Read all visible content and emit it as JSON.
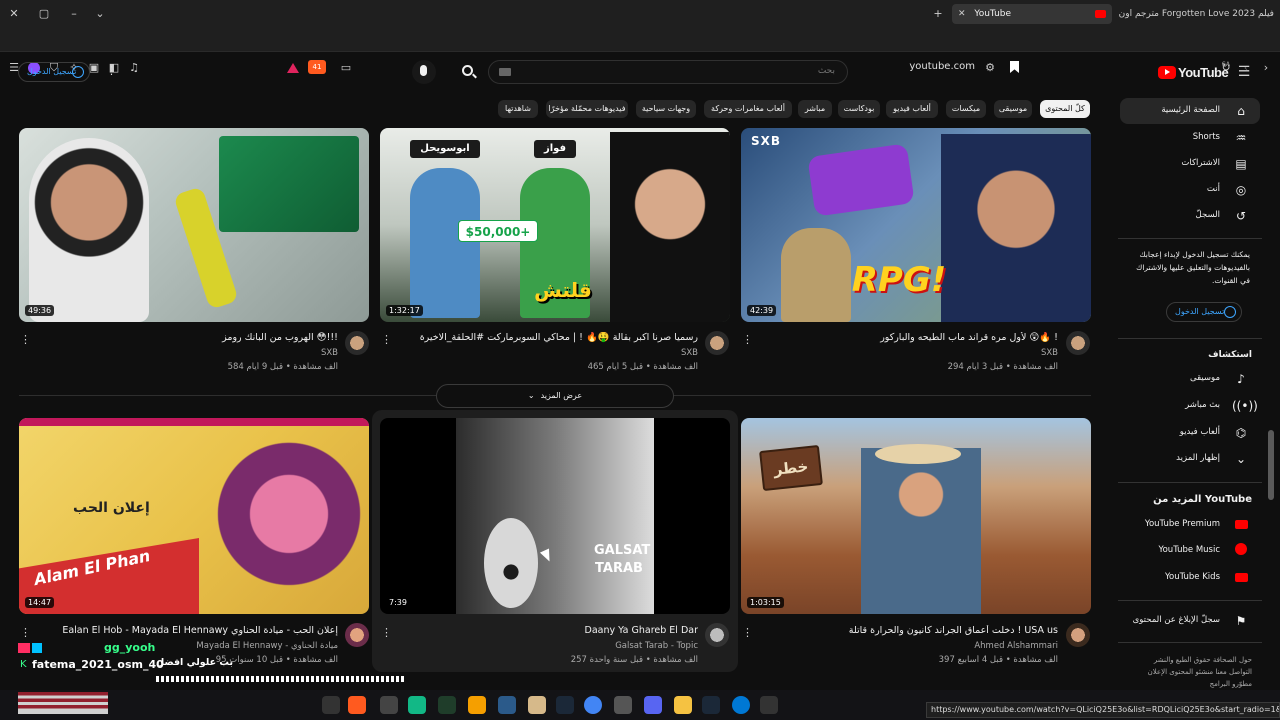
{
  "browser": {
    "tabs": [
      {
        "label": "YouTube",
        "active": true
      },
      {
        "label": "فيلم Forgotten Love 2023 مترجم اون",
        "active": false
      }
    ],
    "url": "youtube.com",
    "badge_count": "41",
    "status_url": "https://www.youtube.com/watch?v=QLiciQ25E3o&list=RDQLiciQ25E3o&start_radio=1&pp=oAcB"
  },
  "header": {
    "logo_text": "YouTube",
    "logo_region": "SA",
    "search_placeholder": "بحث",
    "signin_label": "تسجيل الدخول"
  },
  "chips": [
    {
      "label": "كلّ المحتوى",
      "active": true
    },
    {
      "label": "موسيقى"
    },
    {
      "label": "ميكسات"
    },
    {
      "label": "ألعاب فيديو"
    },
    {
      "label": "بودكاست"
    },
    {
      "label": "مباشر"
    },
    {
      "label": "ألعاب مغامرات وحركة"
    },
    {
      "label": "وجهات سياحية"
    },
    {
      "label": "فيديوهات محمّلة مؤخرًا"
    },
    {
      "label": "شاهدتها"
    }
  ],
  "sidebar": {
    "main": [
      {
        "label": "الصفحة الرئيسية",
        "icon": "home-icon"
      },
      {
        "label": "Shorts",
        "icon": "shorts-icon"
      },
      {
        "label": "الاشتراكات",
        "icon": "subscriptions-icon"
      },
      {
        "label": "أنت",
        "icon": "you-icon"
      },
      {
        "label": "السجلّ",
        "icon": "history-icon"
      }
    ],
    "signin_prompt": "يمكنك تسجيل الدخول لإبداء إعجابك بالفيديوهات والتعليق عليها والاشتراك في القنوات.",
    "signin_label": "تسجيل الدخول",
    "explore_heading": "استكشاف",
    "explore": [
      {
        "label": "موسيقى",
        "icon": "music-icon"
      },
      {
        "label": "بث مباشر",
        "icon": "live-icon"
      },
      {
        "label": "ألعاب فيديو",
        "icon": "gaming-icon"
      },
      {
        "label": "إظهار المزيد",
        "icon": "chevron-down-icon"
      }
    ],
    "more_heading": "المزيد من YouTube",
    "more": [
      {
        "label": "YouTube Premium",
        "icon": "yt-premium-icon"
      },
      {
        "label": "YouTube Music",
        "icon": "yt-music-icon"
      },
      {
        "label": "YouTube Kids",
        "icon": "yt-kids-icon"
      }
    ],
    "report_label": "سجلّ الإبلاغ عن المحتوى",
    "footer_1": "حول  الصحافة  حقوق الطبع والنشر",
    "footer_2": "التواصل معنا  منشئو المحتوى  الإعلان",
    "footer_3": "مطوّرو البرامج"
  },
  "videos_row1": [
    {
      "title": "الهروب من البانك رومز 😳!!!",
      "channel": "SXB",
      "meta": "584 ألف مشاهدة • قبل 9 أيام",
      "duration": "49:36"
    },
    {
      "title": "رسميا صرنا اكبر بقالة 🤑🔥 ! | محاكي السوبرماركت #الحلقة_الاخيرة",
      "channel": "SXB",
      "meta": "465 ألف مشاهدة • قبل 5 أيام",
      "duration": "1:32:17"
    },
    {
      "title": "لأول مره قراند ماب الطيحه والباركور 😲🔥 !",
      "channel": "SXB",
      "meta": "294 ألف مشاهدة • قبل 3 أيام",
      "duration": "42:39"
    }
  ],
  "thumb_text": {
    "v2_tag_left": "ابوسويحل",
    "v2_tag_right": "فواز",
    "v2_price": "$50,000+",
    "v2_big": "قلتش الفلوس!",
    "v3_big": "RPG!",
    "v3_corner": "SXB",
    "v4_text": "إعلان الحب",
    "v4_logo": "Alam El Phan",
    "v5_text": "GALSAT TARAB",
    "v6_sign": "خطر"
  },
  "show_more": "عرض المزيد",
  "videos_row2": [
    {
      "title": "Ealan El Hob - Mayada El Hennawy إعلان الحب - ميادة الحناوي",
      "channel": "Mayada El Hennawy - ميادة الحناوي",
      "meta": "95 ألف مشاهدة • قبل 10 سنوات",
      "duration": "14:47"
    },
    {
      "title": "Daany Ya Ghareb El Dar",
      "channel": "Galsat Tarab - Topic",
      "meta": "257 ألف مشاهدة • قبل سنة واحدة",
      "duration": "7:39"
    },
    {
      "title": "دخلت أعماق الجراند كانيون والحرارة قاتلة ! USA us",
      "channel": "Ahmed Alshammari",
      "meta": "397 ألف مشاهدة • قبل 4 أسابيع",
      "duration": "1:03:15"
    }
  ],
  "overlay_chat": {
    "user1": "gg_yooh",
    "msg1": "بب علولي افضل",
    "user2": "fatema_2021_osm_40"
  }
}
